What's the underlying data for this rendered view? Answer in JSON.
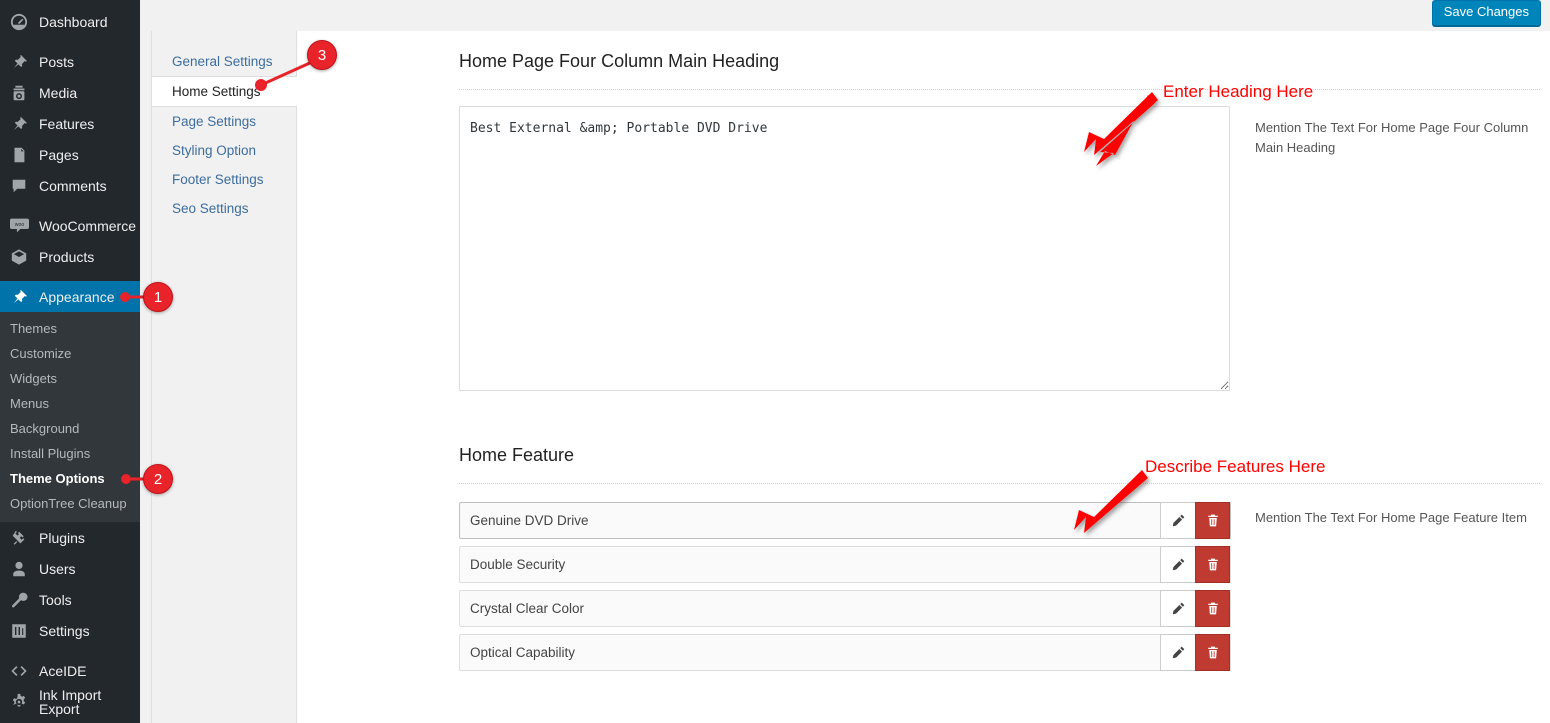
{
  "topbar": {
    "save_label": "Save Changes",
    "save_color": "#0085ba"
  },
  "sidebar": {
    "items": [
      {
        "label": "Dashboard",
        "icon": "dashboard-icon",
        "current": false
      },
      {
        "label": "Posts",
        "icon": "pin-icon",
        "current": false
      },
      {
        "label": "Media",
        "icon": "media-icon",
        "current": false
      },
      {
        "label": "Features",
        "icon": "pin-icon",
        "current": false
      },
      {
        "label": "Pages",
        "icon": "page-icon",
        "current": false
      },
      {
        "label": "Comments",
        "icon": "comment-icon",
        "current": false
      },
      {
        "label": "WooCommerce",
        "icon": "woocommerce-icon",
        "current": false
      },
      {
        "label": "Products",
        "icon": "box-icon",
        "current": false
      },
      {
        "label": "Appearance",
        "icon": "brush-icon",
        "current": true
      },
      {
        "label": "Plugins",
        "icon": "plugin-icon",
        "current": false
      },
      {
        "label": "Users",
        "icon": "user-icon",
        "current": false
      },
      {
        "label": "Tools",
        "icon": "wrench-icon",
        "current": false
      },
      {
        "label": "Settings",
        "icon": "settings-icon",
        "current": false
      },
      {
        "label": "AceIDE",
        "icon": "code-icon",
        "current": false
      },
      {
        "label": "Ink Import Export",
        "icon": "gear-icon",
        "current": false
      }
    ],
    "appearance_submenu": [
      {
        "label": "Themes",
        "current": false
      },
      {
        "label": "Customize",
        "current": false
      },
      {
        "label": "Widgets",
        "current": false
      },
      {
        "label": "Menus",
        "current": false
      },
      {
        "label": "Background",
        "current": false
      },
      {
        "label": "Install Plugins",
        "current": false
      },
      {
        "label": "Theme Options",
        "current": true
      },
      {
        "label": "OptionTree Cleanup",
        "current": false
      }
    ]
  },
  "settings_tabs": [
    {
      "label": "General Settings",
      "active": false
    },
    {
      "label": "Home Settings",
      "active": true
    },
    {
      "label": "Page Settings",
      "active": false
    },
    {
      "label": "Styling Option",
      "active": false
    },
    {
      "label": "Footer Settings",
      "active": false
    },
    {
      "label": "Seo Settings",
      "active": false
    }
  ],
  "sections": {
    "heading": {
      "title": "Home Page Four Column Main Heading",
      "textarea_value": "Best External &amp; Portable DVD Drive",
      "description": "Mention The Text For Home Page Four Column Main Heading"
    },
    "feature": {
      "title": "Home Feature",
      "description": "Mention The Text For Home Page Feature Item",
      "items": [
        {
          "title": "Genuine DVD Drive"
        },
        {
          "title": "Double Security"
        },
        {
          "title": "Crystal Clear Color"
        },
        {
          "title": "Optical Capability"
        }
      ],
      "edit_icon": "pencil-icon",
      "delete_icon": "trash-icon"
    }
  },
  "annotations": {
    "color": "#ff0000",
    "badges": [
      {
        "number": "1"
      },
      {
        "number": "2"
      },
      {
        "number": "3"
      }
    ],
    "labels": [
      {
        "text": "Enter Heading Here"
      },
      {
        "text": "Describe Features Here"
      }
    ]
  }
}
